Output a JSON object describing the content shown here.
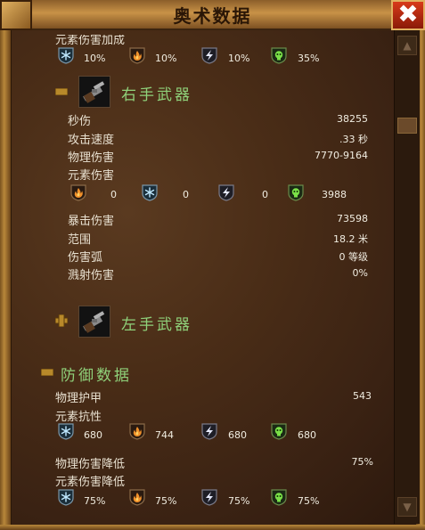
{
  "window": {
    "title": "奥术数据"
  },
  "top_partial": {
    "label": "元素伤害加成",
    "values": [
      "10%",
      "10%",
      "10%",
      "35%"
    ]
  },
  "right_weapon": {
    "title": "右手武器",
    "dps_label": "秒伤",
    "dps": "38255",
    "speed_label": "攻击速度",
    "speed": ".33 秒",
    "phys_label": "物理伤害",
    "phys": "7770-9164",
    "elem_label": "元素伤害",
    "elem_values": [
      "0",
      "0",
      "0",
      "3988"
    ],
    "crit_label": "暴击伤害",
    "crit": "73598",
    "range_label": "范围",
    "range": "18.2 米",
    "arc_label": "伤害弧",
    "arc": "0 等级",
    "splash_label": "溅射伤害",
    "splash": "0%"
  },
  "left_weapon": {
    "title": "左手武器"
  },
  "defense": {
    "title": "防御数据",
    "armor_label": "物理护甲",
    "armor": "543",
    "resist_label": "元素抗性",
    "resist_values": [
      "680",
      "744",
      "680",
      "680"
    ],
    "phys_red_label": "物理伤害降低",
    "phys_red": "75%",
    "elem_red_label": "元素伤害降低",
    "elem_red_values": [
      "75%",
      "75%",
      "75%",
      "75%"
    ]
  },
  "icons": [
    "ice-icon",
    "fire-icon",
    "lightning-icon",
    "poison-icon"
  ],
  "colors": {
    "header": "#8fd17a",
    "text": "#e8e0d0",
    "title": "#2a1606"
  }
}
